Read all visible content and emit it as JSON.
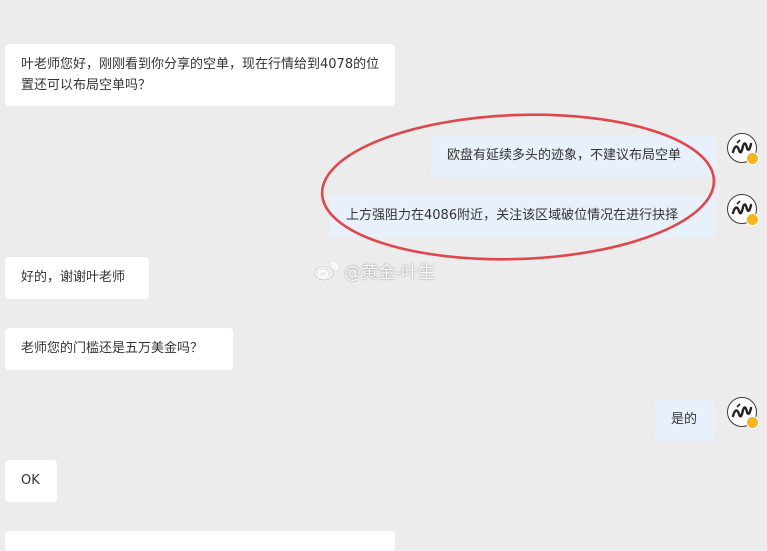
{
  "messages": [
    {
      "side": "left",
      "text": "叶老师您好，刚刚看到你分享的空单，现在行情给到4078的位置还可以布局空单吗？"
    },
    {
      "side": "right",
      "text": "欧盘有延续多头的迹象，不建议布局空单"
    },
    {
      "side": "right",
      "text": "上方强阻力在4086附近，关注该区域破位情况在进行抉择"
    },
    {
      "side": "left",
      "text": "好的，谢谢叶老师"
    },
    {
      "side": "left",
      "text": "老师您的门槛还是五万美金吗？"
    },
    {
      "side": "right",
      "text": "是的"
    },
    {
      "side": "left",
      "text": "OK"
    }
  ],
  "watermark": {
    "text": "@黄金-叶生"
  },
  "colors": {
    "background": "#ececec",
    "bubble_left": "#ffffff",
    "bubble_right": "#e8f1fb",
    "annotation": "#e0474c",
    "badge": "#f3b61f"
  },
  "icons": {
    "avatar": "teacher-avatar-icon",
    "badge": "verified-badge-icon",
    "watermark": "weibo-icon"
  }
}
